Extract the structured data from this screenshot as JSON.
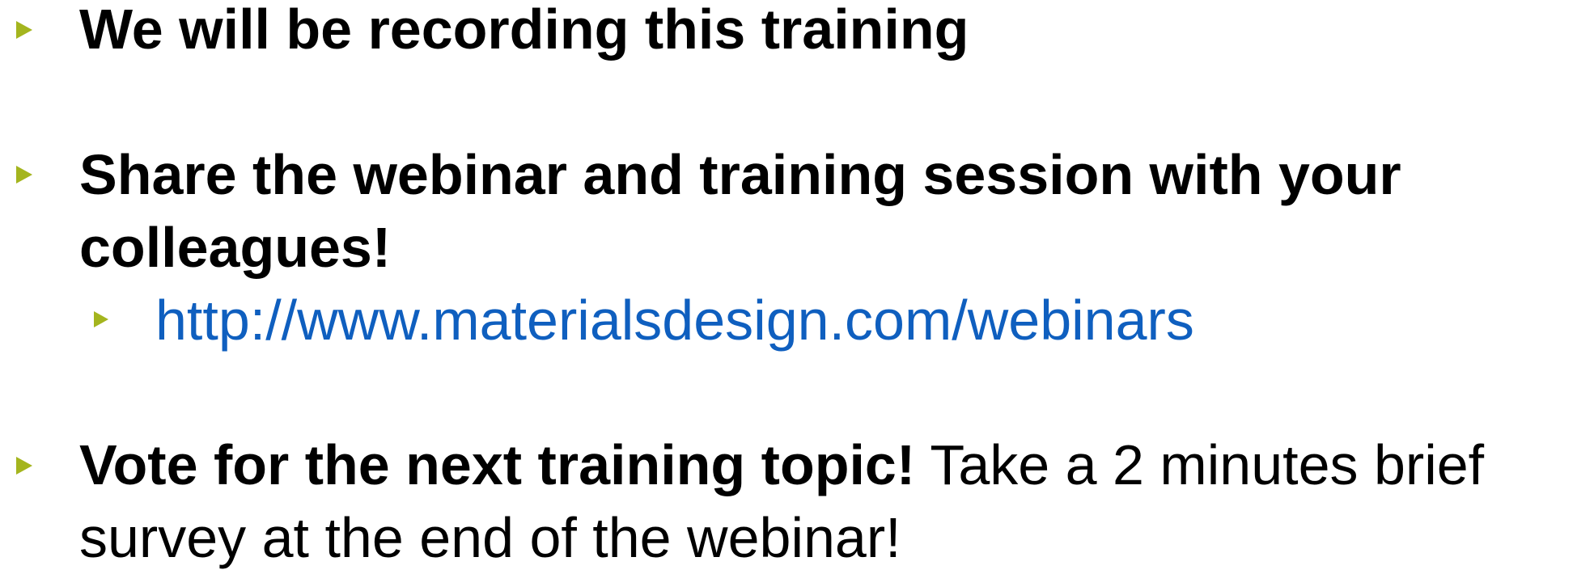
{
  "bullets": {
    "recording": {
      "text": "We will be recording this training"
    },
    "share": {
      "line1": "Share the webinar and training session with your",
      "line2": "colleagues!",
      "link": "http://www.materialsdesign.com/webinars"
    },
    "vote": {
      "bold_text": "Vote for the next training topic!",
      "text_line1": " Take a 2 minutes brief",
      "text_line2": "survey at the end of the webinar!"
    }
  },
  "colors": {
    "bullet_marker": "#a4b51e",
    "link": "#0f5fbf",
    "text": "#000000"
  }
}
